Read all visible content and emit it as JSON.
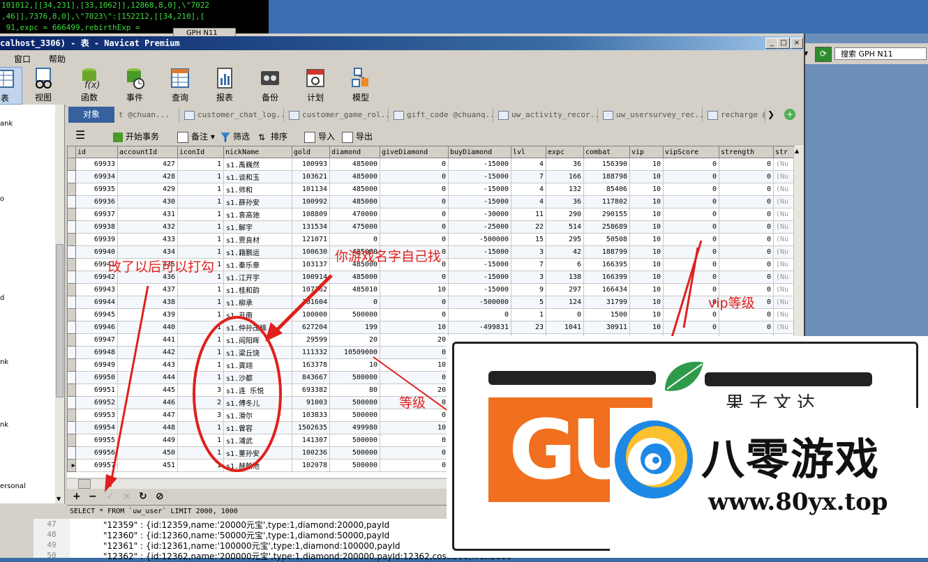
{
  "terminal": {
    "lines": [
      "101012,[[34,231],[33,1062]],12868,8,0],\\\"7022",
      ",46]],7376,8,0],\\\"7023\\\":[152212,[[34,210],[",
      " 91,expc = 666499,rebirthExp = "
    ]
  },
  "behind_tab": {
    "label": "GPH N11"
  },
  "right_panel": {
    "search_placeholder": "搜索 GPH N11"
  },
  "window": {
    "title": "calhost_3306) - 表 - Navicat Premium",
    "buttons": {
      "minimize": "_",
      "maximize": "□",
      "close": "×"
    }
  },
  "menu": {
    "items": [
      "窗口",
      "帮助"
    ]
  },
  "toolbar": {
    "items": [
      {
        "label": "表",
        "icon": "table-icon"
      },
      {
        "label": "视图",
        "icon": "view-icon"
      },
      {
        "label": "函数",
        "icon": "function-icon"
      },
      {
        "label": "事件",
        "icon": "event-icon"
      },
      {
        "label": "查询",
        "icon": "query-icon"
      },
      {
        "label": "报表",
        "icon": "report-icon"
      },
      {
        "label": "备份",
        "icon": "backup-icon"
      },
      {
        "label": "计划",
        "icon": "schedule-icon"
      },
      {
        "label": "模型",
        "icon": "model-icon"
      }
    ]
  },
  "left_panel": {
    "items": [
      "ank",
      "o",
      "d",
      "nk",
      "nk",
      "ersonal"
    ]
  },
  "object_tabs": {
    "main": "对象",
    "tabs": [
      "t @chuan...",
      "customer_chat_log...",
      "customer_game_rol...",
      "gift_code @chuanq...",
      "uw_activity_recor...",
      "uw_usersurvey_rec...",
      "recharge @c"
    ]
  },
  "table_toolbar": {
    "menu_icon": "hamburger-icon",
    "begin_transaction": "开始事务",
    "memo": "备注",
    "filter": "筛选",
    "sort": "排序",
    "import": "导入",
    "export": "导出"
  },
  "grid": {
    "columns": [
      "id",
      "accountId",
      "iconId",
      "nickName",
      "gold",
      "diamond",
      "giveDiamond",
      "buyDiamond",
      "lvl",
      "expc",
      "combat",
      "vip",
      "vipScore",
      "strength",
      "str"
    ],
    "rows": [
      [
        "69933",
        "427",
        "1",
        "s1.禹巍然",
        "100993",
        "485000",
        "0",
        "-15000",
        "4",
        "36",
        "156390",
        "10",
        "0",
        "0",
        "(Nu"
      ],
      [
        "69934",
        "428",
        "1",
        "s1.谈和玉",
        "103621",
        "485000",
        "0",
        "-15000",
        "7",
        "166",
        "188798",
        "10",
        "0",
        "0",
        "(Nu"
      ],
      [
        "69935",
        "429",
        "1",
        "s1.师和",
        "101134",
        "485000",
        "0",
        "-15000",
        "4",
        "132",
        "85406",
        "10",
        "0",
        "0",
        "(Nu"
      ],
      [
        "69936",
        "430",
        "1",
        "s1.薛孙安",
        "100992",
        "485000",
        "0",
        "-15000",
        "4",
        "36",
        "117802",
        "10",
        "0",
        "0",
        "(Nu"
      ],
      [
        "69937",
        "431",
        "1",
        "s1.袁高驰",
        "108809",
        "470000",
        "0",
        "-30000",
        "11",
        "290",
        "290155",
        "10",
        "0",
        "0",
        "(Nu"
      ],
      [
        "69938",
        "432",
        "1",
        "s1.解宇",
        "131534",
        "475000",
        "0",
        "-25000",
        "22",
        "514",
        "258689",
        "10",
        "0",
        "0",
        "(Nu"
      ],
      [
        "69939",
        "433",
        "1",
        "s1.贾良材",
        "121071",
        "0",
        "0",
        "-500000",
        "15",
        "295",
        "50508",
        "10",
        "0",
        "0",
        "(Nu"
      ],
      [
        "69940",
        "434",
        "1",
        "s1.籍鹏运",
        "100630",
        "485000",
        "0",
        "-15000",
        "3",
        "42",
        "188799",
        "10",
        "0",
        "0",
        "(Nu"
      ],
      [
        "69941",
        "435",
        "1",
        "s1.秦乐章",
        "103137",
        "485000",
        "0",
        "-15000",
        "7",
        "6",
        "166395",
        "10",
        "0",
        "0",
        "(Nu"
      ],
      [
        "69942",
        "436",
        "1",
        "s1.江开宇",
        "100914",
        "485000",
        "0",
        "-15000",
        "3",
        "138",
        "166399",
        "10",
        "0",
        "0",
        "(Nu"
      ],
      [
        "69943",
        "437",
        "1",
        "s1.桂和韵",
        "107262",
        "485010",
        "10",
        "-15000",
        "9",
        "297",
        "166434",
        "10",
        "0",
        "0",
        "(Nu"
      ],
      [
        "69944",
        "438",
        "1",
        "s1.柳承",
        "101604",
        "0",
        "0",
        "-500000",
        "5",
        "124",
        "31799",
        "10",
        "0",
        "0",
        "(Nu"
      ],
      [
        "69945",
        "439",
        "1",
        "s1.丑南",
        "100000",
        "500000",
        "0",
        "0",
        "1",
        "0",
        "1500",
        "10",
        "0",
        "0",
        "(Nu"
      ],
      [
        "69946",
        "440",
        "1",
        "s1.仲孙茂楠",
        "627204",
        "199",
        "10",
        "-499831",
        "23",
        "1041",
        "30911",
        "10",
        "0",
        "0",
        "(Nu"
      ],
      [
        "69947",
        "441",
        "1",
        "s1.阎阳晖",
        "29599",
        "20",
        "20",
        "-500000",
        "15",
        "1001",
        "63692",
        "10",
        "0",
        "0",
        "(Nu"
      ],
      [
        "69948",
        "442",
        "1",
        "s1.梁丘饶",
        "111332",
        "10509000",
        "0",
        "",
        "",
        "",
        "",
        "",
        "",
        "",
        ""
      ],
      [
        "69949",
        "443",
        "1",
        "s1.龚翊",
        "163378",
        "10",
        "10",
        "",
        "",
        "",
        "",
        "",
        "",
        "",
        ""
      ],
      [
        "69950",
        "444",
        "1",
        "s1.沙都",
        "843667",
        "500000",
        "0",
        "",
        "",
        "",
        "",
        "",
        "",
        "",
        ""
      ],
      [
        "69951",
        "445",
        "3",
        "s1.连 乐悦",
        "693382",
        "80",
        "20",
        "",
        "",
        "",
        "",
        "",
        "",
        "",
        ""
      ],
      [
        "69952",
        "446",
        "2",
        "s1.傅冬儿",
        "91003",
        "500000",
        "0",
        "",
        "",
        "",
        "",
        "",
        "",
        "",
        ""
      ],
      [
        "69953",
        "447",
        "3",
        "s1.滑尔",
        "103833",
        "500000",
        "0",
        "",
        "",
        "",
        "",
        "",
        "",
        "",
        ""
      ],
      [
        "69954",
        "448",
        "1",
        "s1.曾容",
        "1502635",
        "499980",
        "10",
        "",
        "",
        "",
        "",
        "",
        "",
        "",
        ""
      ],
      [
        "69955",
        "449",
        "1",
        "s1.浦武",
        "141307",
        "500000",
        "0",
        "",
        "",
        "",
        "",
        "",
        "",
        "",
        ""
      ],
      [
        "69956",
        "450",
        "1",
        "s1.董孙安",
        "100236",
        "500000",
        "0",
        "",
        "",
        "",
        "",
        "",
        "",
        "",
        ""
      ],
      [
        "69957",
        "451",
        "1",
        "s1.赫翰池",
        "102078",
        "500000",
        "0",
        "",
        "",
        "",
        "",
        "",
        "",
        "",
        ""
      ]
    ]
  },
  "status_bar": {
    "sql": "SELECT * FROM `uw_user` LIMIT 2000, 1000"
  },
  "nav": {
    "add": "+",
    "delete": "−",
    "apply": "✓",
    "cancel": "×",
    "refresh": "↻",
    "stop": "⊘"
  },
  "code": {
    "lines": [
      {
        "num": "47",
        "text": "\"12359\" : {id:12359,name:'20000元宝',type:1,diamond:20000,payId"
      },
      {
        "num": "48",
        "text": "\"12360\" : {id:12360,name:'50000元宝',type:1,diamond:50000,payId"
      },
      {
        "num": "49",
        "text": "\"12361\" : {id:12361,name:'100000元宝',type:1,diamond:100000,payId"
      },
      {
        "num": "50",
        "text": "\"12362\" : {id:12362,name:'200000元宝',type:1,diamond:200000,payId:12362,cost:200,first:2000"
      }
    ]
  },
  "annotations": {
    "print_after_edit": "改了以后可以打勾",
    "find_own_name": "你游戏名字自己找",
    "level": "等级",
    "vip_level": "vip等级"
  },
  "watermark": {
    "logo_text": "GU",
    "site_name": "八零游戏",
    "url": "www.80yx.top",
    "sub": "果子文达"
  },
  "colors": {
    "title_bar": "#0a246a",
    "annotation": "#e0201c",
    "object_tab": "#36609e",
    "watermark_orange": "#f07020"
  }
}
